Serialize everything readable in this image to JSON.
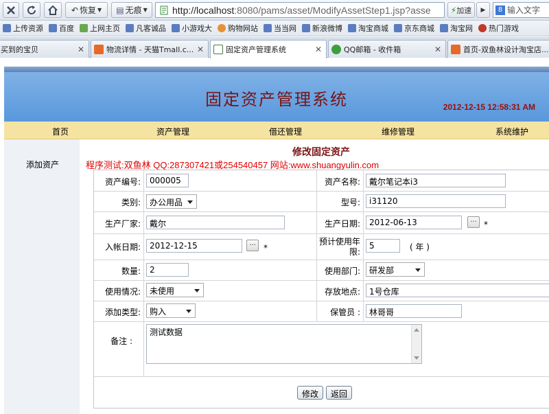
{
  "browser": {
    "toolbar": {
      "back_label": "恢复",
      "traceless_label": "无痕",
      "url_host": "http://localhost",
      "url_rest": ":8080/pams/asset/ModifyAssetStep1.jsp?asse",
      "speedup_label": "加速",
      "search_placeholder": "输入文字"
    },
    "bookmarks": [
      "上传资源",
      "百度",
      "上网主页",
      "凡客诚品",
      "小游戏大",
      "购物网站",
      "当当网",
      "新浪微博",
      "淘宝商城",
      "京东商城",
      "淘宝网",
      "热门游戏"
    ],
    "tabs": [
      {
        "title": "买到的宝贝",
        "active": false
      },
      {
        "title": "物流详情 - 天猫Tmall.c...",
        "active": false
      },
      {
        "title": "固定资产管理系统",
        "active": true
      },
      {
        "title": "QQ邮箱 - 收件箱",
        "active": false
      },
      {
        "title": "首页-双鱼林设计淘宝店...",
        "active": false
      }
    ]
  },
  "header": {
    "title": "固定资产管理系统",
    "datetime": "2012-12-15 12:58:31 AM"
  },
  "nav": [
    "首页",
    "资产管理",
    "借还管理",
    "维修管理",
    "系统维护"
  ],
  "sidebar": {
    "item": "添加资产"
  },
  "form": {
    "title": "修改固定资产",
    "credit": "程序测试:双鱼林 QQ:287307421或254540457 网站:www.shuangyulin.com",
    "asset_no_label": "资产编号:",
    "asset_no": "000005",
    "asset_name_label": "资产名称:",
    "asset_name": "戴尔笔记本i3",
    "category_label": "类别:",
    "category": "办公用品",
    "model_label": "型号:",
    "model": "i31120",
    "manufacturer_label": "生产厂家:",
    "manufacturer": "戴尔",
    "production_date_label": "生产日期:",
    "production_date": "2012-06-13",
    "entry_date_label": "入帐日期:",
    "entry_date": "2012-12-15",
    "lifespan_label_1": "预计使用年",
    "lifespan_label_2": "限:",
    "lifespan": "5",
    "lifespan_unit": "( 年 )",
    "quantity_label": "数量:",
    "quantity": "2",
    "department_label": "使用部门:",
    "department": "研发部",
    "usage_label": "使用情况:",
    "usage": "未使用",
    "location_label": "存放地点:",
    "location": "1号仓库",
    "add_type_label": "添加类型:",
    "add_type": "购入",
    "keeper_label": "保管员 :",
    "keeper": "林哥哥",
    "remark_label": "备注 :",
    "remark": "测试数据",
    "required_mark": "*",
    "calendar_glyph": "...",
    "submit_label": "修改",
    "back_label": "返回"
  }
}
